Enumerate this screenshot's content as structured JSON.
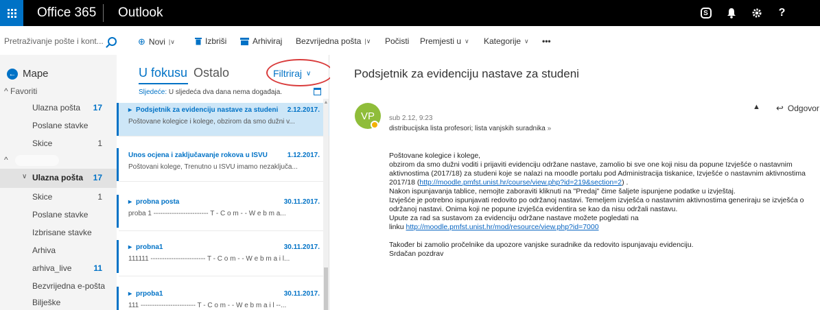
{
  "topbar": {
    "brand": "Office 365",
    "app": "Outlook",
    "icons": [
      "skype-icon",
      "bell-icon",
      "gear-icon",
      "help-icon"
    ],
    "help_label": "?"
  },
  "search": {
    "placeholder": "Pretraživanje pošte i kont..."
  },
  "commands": {
    "new": "Novi",
    "delete": "Izbriši",
    "archive": "Arhiviraj",
    "junk": "Bezvrijedna pošta",
    "sweep": "Počisti",
    "move": "Premjesti u",
    "categories": "Kategorije",
    "more": "•••"
  },
  "folders": {
    "title": "Mape",
    "favorites_label": "Favoriti",
    "favorites": [
      {
        "label": "Ulazna pošta",
        "count": "17"
      },
      {
        "label": "Poslane stavke",
        "count": ""
      },
      {
        "label": "Skice",
        "count": "1"
      }
    ],
    "account_items": [
      {
        "label": "Ulazna pošta",
        "count": "17"
      },
      {
        "label": "Skice",
        "count": "1"
      },
      {
        "label": "Poslane stavke",
        "count": ""
      },
      {
        "label": "Izbrisane stavke",
        "count": ""
      },
      {
        "label": "Arhiva",
        "count": ""
      },
      {
        "label": "arhiva_live",
        "count": "11"
      },
      {
        "label": "Bezvrijedna e-pošta",
        "count": ""
      },
      {
        "label": "Bilješke",
        "count": ""
      }
    ]
  },
  "list": {
    "tab_focused": "U fokusu",
    "tab_other": "Ostalo",
    "filter": "Filtriraj",
    "next_label": "Sljedeće:",
    "next_text": "U sljedeća dva dana nema događaja.",
    "messages": [
      {
        "subject": "Podsjetnik za evidenciju nastave za studeni",
        "date": "2.12.2017.",
        "preview": "Poštovane kolegice i kolege, obzirom da smo dužni v..."
      },
      {
        "subject": "Unos ocjena i zaključavanje rokova u ISVU",
        "date": "1.12.2017.",
        "preview": "Poštovani kolege, Trenutno u ISVU imamo nezaključa..."
      },
      {
        "subject": "probna posta",
        "date": "30.11.2017.",
        "preview": "proba 1 ------------------------ T - C o m - - W e b m a..."
      },
      {
        "subject": "probna1",
        "date": "30.11.2017.",
        "preview": "111111 ------------------------ T - C o m - - W e b m a i l..."
      },
      {
        "subject": "prpoba1",
        "date": "30.11.2017.",
        "preview": "111 ------------------------ T - C o m - - W e b m a i l --..."
      }
    ]
  },
  "reading": {
    "subject": "Podsjetnik za evidenciju nastave za studeni",
    "avatar": "VP",
    "date": "sub 2.12, 9:23",
    "to": "distribucijska lista profesori; lista vanjskih suradnika",
    "reply": "Odgovor",
    "body": [
      "Poštovane kolegice i kolege,",
      "obzirom da smo dužni voditi i prijaviti evidenciju održane nastave, zamolio bi sve one koji nisu da popune Izvješće o nastavnim",
      "aktivnostima (2017/18) za studeni koje se nalazi na moodle portalu pod Administracija tiskanice, Izvješće o nastavnim aktivnostima",
      "2017/18 (",
      "http://moodle.pmfst.unist.hr/course/view.php?id=219&section=2",
      ") .",
      "Nakon ispunjavanja tablice, nemojte zaboraviti kliknuti na \"Predaj\" čime šaljete ispunjene podatke u izvještaj.",
      "Izvješće je potrebno ispunjavati redovito po održanoj nastavi. Temeljem izvješća o nastavnim aktivnostima generiraju se izvješća o",
      "održanoj nastavi. Onima koji ne popune izvješća evidentira se kao da nisu održali nastavu.",
      "Upute za rad sa sustavom za evidenciju održane nastave možete pogledati na",
      "linku ",
      "http://moodle.pmfst.unist.hr/mod/resource/view.php?id=7000",
      "Također bi zamolio pročelnike da upozore vanjske suradnike da redovito ispunjavaju evidenciju.",
      "Srdačan pozdrav"
    ]
  },
  "colors": {
    "brand_blue": "#0072c6",
    "selected_row": "#cde6f7",
    "annotation_red": "#d93b3b",
    "avatar_green": "#8fbd3a"
  }
}
